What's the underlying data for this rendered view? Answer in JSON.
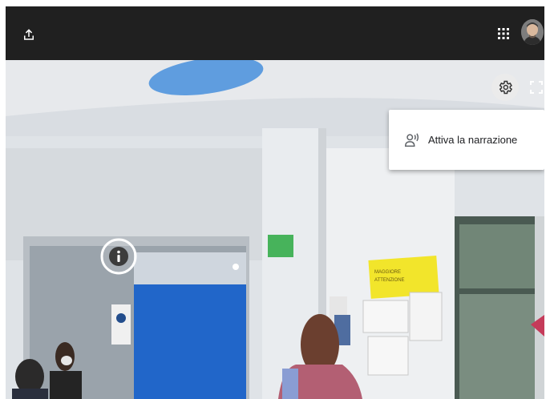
{
  "toolbar": {
    "upload_icon": "upload-icon",
    "apps_icon": "apps-grid-icon",
    "background": "#202020"
  },
  "player": {
    "settings_icon": "gear-icon",
    "fullscreen_icon": "fullscreen-icon",
    "info_icon": "info-icon"
  },
  "settings_menu": {
    "items": [
      {
        "icon": "narration-voice-icon",
        "label": "Attiva la narrazione"
      }
    ]
  },
  "scene_sign": {
    "text_line1": "MAGGIORE",
    "text_line2": "ATTENZIONE"
  }
}
